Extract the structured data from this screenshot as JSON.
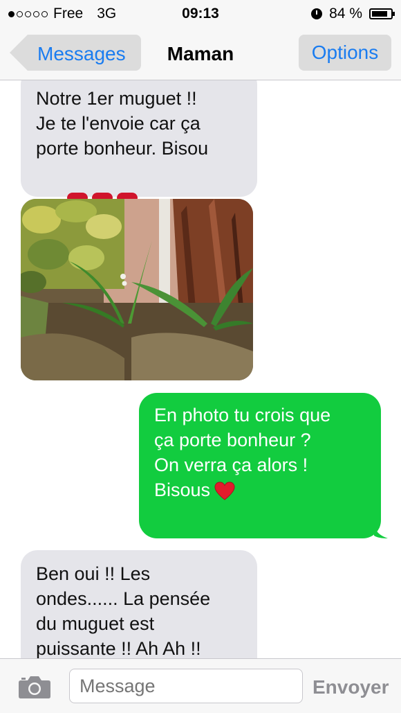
{
  "status_bar": {
    "signal_total": 5,
    "signal_filled": 1,
    "carrier": "Free",
    "network": "3G",
    "time": "09:13",
    "battery": "84 %",
    "battery_level": 0.84,
    "icons": [
      "alarm-icon",
      "battery-icon"
    ]
  },
  "nav": {
    "back_label": "Messages",
    "title": "Maman",
    "options_label": "Options"
  },
  "messages": [
    {
      "direction": "incoming",
      "lines": [
        "Notre 1er muguet !!",
        "Je te l'envoie car ça",
        "porte bonheur. Bisou"
      ],
      "emoji": [
        "💋",
        "💋",
        "💋"
      ]
    },
    {
      "direction": "incoming",
      "type": "photo",
      "image": "lily-of-the-valley-photo"
    },
    {
      "direction": "outgoing",
      "lines": [
        "En photo tu crois que",
        "ça porte bonheur ?",
        "On verra ça alors !",
        "",
        "Bisous"
      ],
      "emoji": [
        "❤️"
      ]
    },
    {
      "direction": "incoming",
      "lines": [
        "Ben oui !! Les",
        "ondes...... La pensée",
        "du muguet est",
        "puissante !! Ah Ah !!"
      ]
    }
  ],
  "input_bar": {
    "placeholder": "Message",
    "send_label": "Envoyer",
    "camera_icon": "camera-icon"
  },
  "colors": {
    "ios_blue": "#1a7cf0",
    "incoming_bubble": "#e5e5ea",
    "outgoing_bubble": "#12cc3f"
  }
}
